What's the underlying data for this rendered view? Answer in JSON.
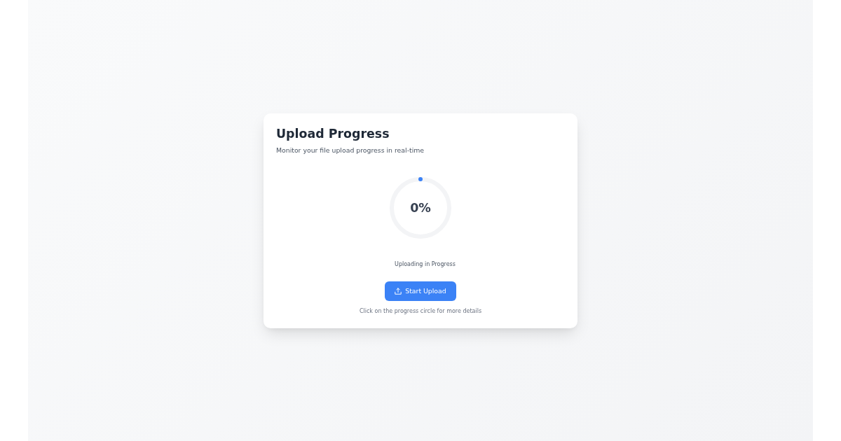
{
  "card": {
    "title": "Upload Progress",
    "subtitle": "Monitor your file upload progress in real-time",
    "progress": {
      "level": 0,
      "label": "0%"
    },
    "status": "Uploading in Progress",
    "button": {
      "label": "Start Upload"
    },
    "hint": "Click on the progress circle for more details"
  }
}
